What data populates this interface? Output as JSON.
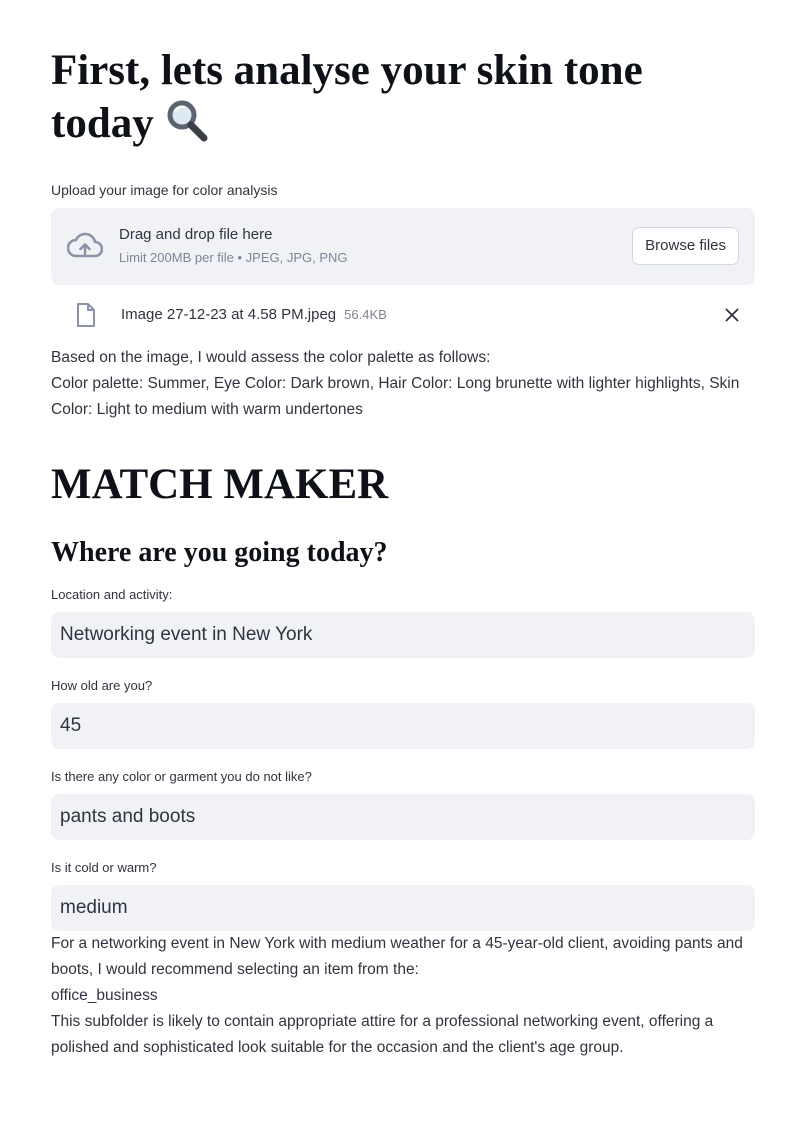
{
  "header": {
    "title": "First, lets analyse your skin tone today",
    "title_icon": "magnifier-icon"
  },
  "uploader": {
    "label": "Upload your image for color analysis",
    "drop_title": "Drag and drop file here",
    "drop_subtitle": "Limit 200MB per file • JPEG, JPG, PNG",
    "browse_label": "Browse files",
    "file": {
      "name": "Image 27-12-23 at 4.58 PM.jpeg",
      "size": "56.4KB"
    }
  },
  "analysis": {
    "intro": "Based on the image, I would assess the color palette as follows:",
    "result": "Color palette: Summer, Eye Color: Dark brown, Hair Color: Long brunette with lighter highlights, Skin Color: Light to medium with warm undertones"
  },
  "match": {
    "title": "MATCH MAKER",
    "subtitle": "Where are you going today?"
  },
  "fields": [
    {
      "label": "Location and activity:",
      "value": "Networking event in New York"
    },
    {
      "label": "How old are you?",
      "value": "45"
    },
    {
      "label": "Is there any color or garment you do not like?",
      "value": "pants and boots"
    },
    {
      "label": "Is it cold or warm?",
      "value": "medium"
    }
  ],
  "recommendation": {
    "intro": "For a networking event in New York with medium weather for a 45-year-old client, avoiding pants and boots, I would recommend selecting an item from the:",
    "folder": "office_business",
    "explanation": "This subfolder is likely to contain appropriate attire for a professional networking event, offering a polished and sophisticated look suitable for the occasion and the client's age group."
  }
}
